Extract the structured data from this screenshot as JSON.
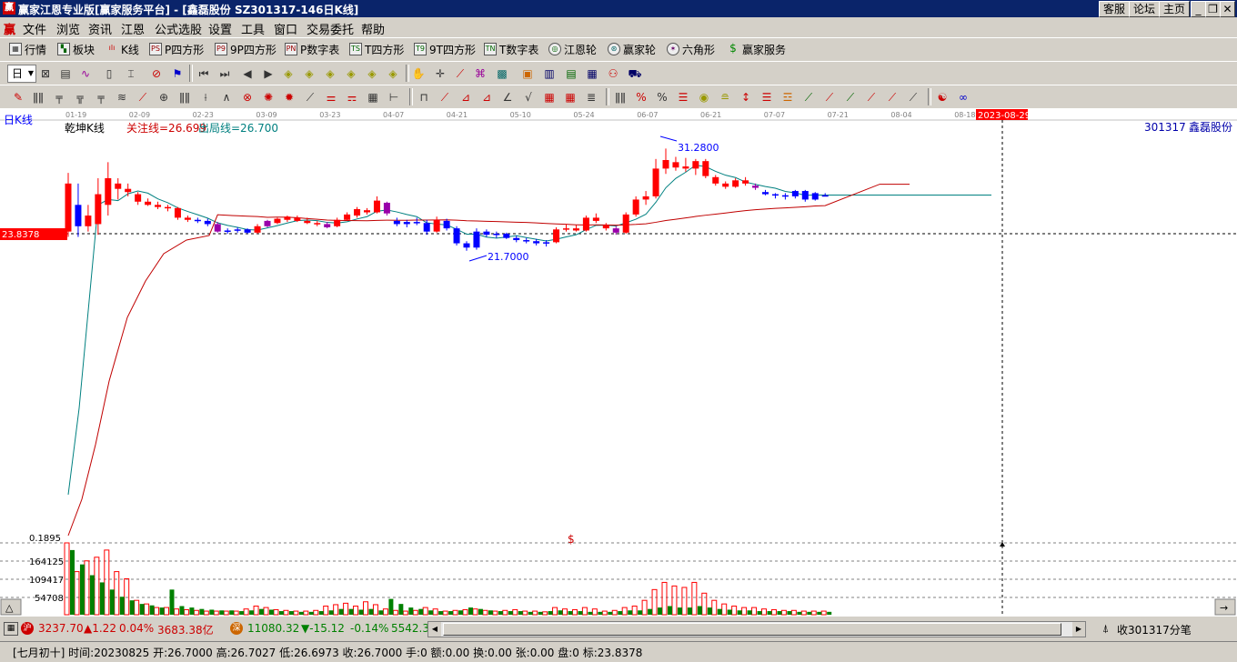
{
  "window": {
    "app_icon": "赢",
    "title": "赢家江恩专业版[赢家服务平台] - [鑫磊股份  SZ301317-146日K线]",
    "buttons": [
      "客服",
      "论坛",
      "主页"
    ]
  },
  "menu": [
    "文件",
    "浏览",
    "资讯",
    "江恩",
    "公式选股",
    "设置",
    "工具",
    "窗口",
    "交易委托",
    "帮助"
  ],
  "toolbar1": [
    {
      "icon": "market-icon",
      "label": "行情"
    },
    {
      "icon": "sector-icon",
      "label": "板块"
    },
    {
      "icon": "kline-icon",
      "label": "K线"
    },
    {
      "icon": "ps-icon",
      "label": "P四方形"
    },
    {
      "icon": "p9-icon",
      "label": "9P四方形"
    },
    {
      "icon": "pn-icon",
      "label": "P数字表"
    },
    {
      "icon": "ts-icon",
      "label": "T四方形"
    },
    {
      "icon": "t9-icon",
      "label": "9T四方形"
    },
    {
      "icon": "tn-icon",
      "label": "T数字表"
    },
    {
      "icon": "gann-wheel-icon",
      "label": "江恩轮"
    },
    {
      "icon": "winner-wheel-icon",
      "label": "赢家轮"
    },
    {
      "icon": "hexagon-icon",
      "label": "六角形"
    },
    {
      "icon": "service-icon",
      "label": "赢家服务"
    }
  ],
  "period_select": "日",
  "chart": {
    "corner_label": "日K线",
    "indicator_name": "乾坤K线",
    "focus_label": "关注线=26.699",
    "exit_label": "出局线=26.700",
    "stock_code": "301317",
    "stock_name": "鑫磊股份",
    "price_marker": "23.8378",
    "high_annotation": "31.2800",
    "low_annotation": "21.7000",
    "cursor_date": "2023-08-29",
    "date_ticks": [
      "01-19",
      "02-09",
      "02-23",
      "03-09",
      "03-23",
      "04-07",
      "04-21",
      "05-10",
      "05-24",
      "06-07",
      "06-21",
      "07-07",
      "07-21",
      "08-04",
      "08-18"
    ],
    "volume_labels": [
      "0.1895",
      "164125",
      "109417",
      "54708"
    ],
    "dollar_mark": "$",
    "colors": {
      "up": "#ff0000",
      "down": "#0000ff",
      "purple": "#9900aa",
      "vol_up": "#ff0000",
      "vol_down": "#008000",
      "ma_short": "#008080",
      "ma_long": "#c00000"
    }
  },
  "chart_data": {
    "type": "candlestick",
    "ylim": [
      10,
      35
    ],
    "candles": [
      {
        "o": 23.5,
        "h": 29.0,
        "l": 23.0,
        "c": 28.0,
        "d": "u"
      },
      {
        "o": 26.0,
        "h": 28.0,
        "l": 23.0,
        "c": 24.0,
        "d": "d"
      },
      {
        "o": 24.0,
        "h": 26.0,
        "l": 23.5,
        "c": 25.0,
        "d": "u"
      },
      {
        "o": 24.2,
        "h": 28.5,
        "l": 23.2,
        "c": 27.0,
        "d": "u"
      },
      {
        "o": 26.0,
        "h": 30.0,
        "l": 25.0,
        "c": 28.5,
        "d": "u"
      },
      {
        "o": 28.0,
        "h": 28.5,
        "l": 26.5,
        "c": 27.5,
        "d": "u"
      },
      {
        "o": 27.5,
        "h": 28.0,
        "l": 26.8,
        "c": 27.2,
        "d": "u"
      },
      {
        "o": 27.0,
        "h": 27.2,
        "l": 26.0,
        "c": 26.3,
        "d": "u"
      },
      {
        "o": 26.3,
        "h": 26.6,
        "l": 25.9,
        "c": 26.0,
        "d": "u"
      },
      {
        "o": 26.0,
        "h": 26.3,
        "l": 25.6,
        "c": 25.8,
        "d": "u"
      },
      {
        "o": 25.8,
        "h": 26.0,
        "l": 25.4,
        "c": 25.7,
        "d": "u"
      },
      {
        "o": 25.7,
        "h": 25.8,
        "l": 24.6,
        "c": 24.8,
        "d": "u"
      },
      {
        "o": 24.8,
        "h": 25.0,
        "l": 24.4,
        "c": 24.6,
        "d": "u"
      },
      {
        "o": 24.6,
        "h": 24.8,
        "l": 24.3,
        "c": 24.5,
        "d": "d"
      },
      {
        "o": 24.5,
        "h": 24.7,
        "l": 24.0,
        "c": 24.2,
        "d": "d"
      },
      {
        "o": 24.2,
        "h": 24.4,
        "l": 23.4,
        "c": 23.5,
        "d": "p"
      },
      {
        "o": 23.5,
        "h": 23.8,
        "l": 23.3,
        "c": 23.6,
        "d": "d"
      },
      {
        "o": 23.6,
        "h": 23.9,
        "l": 23.4,
        "c": 23.7,
        "d": "d"
      },
      {
        "o": 23.7,
        "h": 23.8,
        "l": 23.3,
        "c": 23.4,
        "d": "d"
      },
      {
        "o": 23.4,
        "h": 24.2,
        "l": 23.3,
        "c": 24.0,
        "d": "u"
      },
      {
        "o": 24.0,
        "h": 24.6,
        "l": 23.9,
        "c": 24.5,
        "d": "p"
      },
      {
        "o": 24.3,
        "h": 24.8,
        "l": 24.2,
        "c": 24.7,
        "d": "u"
      },
      {
        "o": 24.6,
        "h": 25.0,
        "l": 24.4,
        "c": 24.9,
        "d": "u"
      },
      {
        "o": 24.8,
        "h": 25.0,
        "l": 24.4,
        "c": 24.5,
        "d": "u"
      },
      {
        "o": 24.5,
        "h": 24.8,
        "l": 24.2,
        "c": 24.3,
        "d": "u"
      },
      {
        "o": 24.3,
        "h": 24.5,
        "l": 24.0,
        "c": 24.2,
        "d": "u"
      },
      {
        "o": 24.2,
        "h": 24.4,
        "l": 23.8,
        "c": 23.9,
        "d": "p"
      },
      {
        "o": 24.0,
        "h": 24.8,
        "l": 23.9,
        "c": 24.6,
        "d": "u"
      },
      {
        "o": 24.6,
        "h": 25.3,
        "l": 24.5,
        "c": 25.1,
        "d": "u"
      },
      {
        "o": 25.0,
        "h": 25.8,
        "l": 24.8,
        "c": 25.6,
        "d": "u"
      },
      {
        "o": 25.5,
        "h": 25.7,
        "l": 25.1,
        "c": 25.3,
        "d": "u"
      },
      {
        "o": 25.3,
        "h": 26.8,
        "l": 25.2,
        "c": 26.4,
        "d": "u"
      },
      {
        "o": 26.2,
        "h": 26.3,
        "l": 25.0,
        "c": 25.2,
        "d": "p"
      },
      {
        "o": 24.5,
        "h": 24.8,
        "l": 24.0,
        "c": 24.2,
        "d": "d"
      },
      {
        "o": 24.2,
        "h": 24.6,
        "l": 23.9,
        "c": 24.4,
        "d": "d"
      },
      {
        "o": 24.4,
        "h": 24.8,
        "l": 24.1,
        "c": 24.3,
        "d": "d"
      },
      {
        "o": 24.3,
        "h": 24.6,
        "l": 23.2,
        "c": 23.5,
        "d": "d"
      },
      {
        "o": 23.5,
        "h": 24.9,
        "l": 23.4,
        "c": 24.6,
        "d": "u"
      },
      {
        "o": 24.5,
        "h": 24.7,
        "l": 23.6,
        "c": 23.8,
        "d": "d"
      },
      {
        "o": 23.8,
        "h": 24.0,
        "l": 22.2,
        "c": 22.4,
        "d": "d"
      },
      {
        "o": 22.4,
        "h": 22.6,
        "l": 21.7,
        "c": 22.0,
        "d": "d"
      },
      {
        "o": 22.0,
        "h": 23.8,
        "l": 21.8,
        "c": 23.5,
        "d": "d"
      },
      {
        "o": 23.5,
        "h": 23.7,
        "l": 23.0,
        "c": 23.2,
        "d": "d"
      },
      {
        "o": 23.2,
        "h": 23.5,
        "l": 22.9,
        "c": 23.3,
        "d": "d"
      },
      {
        "o": 23.3,
        "h": 23.4,
        "l": 22.8,
        "c": 22.9,
        "d": "d"
      },
      {
        "o": 22.9,
        "h": 23.1,
        "l": 22.5,
        "c": 22.7,
        "d": "d"
      },
      {
        "o": 22.7,
        "h": 22.9,
        "l": 22.4,
        "c": 22.6,
        "d": "d"
      },
      {
        "o": 22.6,
        "h": 22.8,
        "l": 22.2,
        "c": 22.4,
        "d": "d"
      },
      {
        "o": 22.4,
        "h": 22.7,
        "l": 22.1,
        "c": 22.5,
        "d": "d"
      },
      {
        "o": 22.5,
        "h": 23.9,
        "l": 22.4,
        "c": 23.7,
        "d": "u"
      },
      {
        "o": 23.7,
        "h": 24.2,
        "l": 23.5,
        "c": 23.8,
        "d": "u"
      },
      {
        "o": 23.8,
        "h": 24.1,
        "l": 23.5,
        "c": 23.6,
        "d": "u"
      },
      {
        "o": 23.6,
        "h": 25.0,
        "l": 23.5,
        "c": 24.8,
        "d": "u"
      },
      {
        "o": 24.8,
        "h": 25.2,
        "l": 24.3,
        "c": 24.5,
        "d": "u"
      },
      {
        "o": 24.1,
        "h": 24.3,
        "l": 23.6,
        "c": 23.8,
        "d": "u"
      },
      {
        "o": 23.8,
        "h": 24.0,
        "l": 23.2,
        "c": 23.4,
        "d": "p"
      },
      {
        "o": 23.4,
        "h": 25.3,
        "l": 23.3,
        "c": 25.1,
        "d": "u"
      },
      {
        "o": 25.1,
        "h": 26.8,
        "l": 24.9,
        "c": 26.5,
        "d": "u"
      },
      {
        "o": 26.5,
        "h": 27.3,
        "l": 26.0,
        "c": 26.8,
        "d": "u"
      },
      {
        "o": 26.8,
        "h": 30.3,
        "l": 26.6,
        "c": 29.4,
        "d": "u"
      },
      {
        "o": 29.4,
        "h": 31.28,
        "l": 28.9,
        "c": 30.2,
        "d": "u"
      },
      {
        "o": 30.0,
        "h": 30.5,
        "l": 29.2,
        "c": 29.5,
        "d": "u"
      },
      {
        "o": 29.6,
        "h": 30.4,
        "l": 29.1,
        "c": 29.4,
        "d": "u"
      },
      {
        "o": 29.4,
        "h": 30.3,
        "l": 28.8,
        "c": 30.1,
        "d": "u"
      },
      {
        "o": 30.1,
        "h": 30.3,
        "l": 28.5,
        "c": 28.7,
        "d": "u"
      },
      {
        "o": 28.6,
        "h": 28.8,
        "l": 27.8,
        "c": 28.0,
        "d": "u"
      },
      {
        "o": 28.0,
        "h": 28.2,
        "l": 27.5,
        "c": 27.7,
        "d": "u"
      },
      {
        "o": 27.7,
        "h": 28.5,
        "l": 27.6,
        "c": 28.3,
        "d": "u"
      },
      {
        "o": 28.3,
        "h": 28.6,
        "l": 27.8,
        "c": 28.0,
        "d": "u"
      },
      {
        "o": 27.8,
        "h": 28.0,
        "l": 27.4,
        "c": 27.6,
        "d": "p"
      },
      {
        "o": 27.2,
        "h": 27.4,
        "l": 26.9,
        "c": 27.0,
        "d": "d"
      },
      {
        "o": 27.0,
        "h": 27.1,
        "l": 26.6,
        "c": 26.9,
        "d": "d"
      },
      {
        "o": 26.9,
        "h": 27.1,
        "l": 26.5,
        "c": 26.8,
        "d": "d"
      },
      {
        "o": 26.8,
        "h": 27.4,
        "l": 26.6,
        "c": 27.3,
        "d": "d"
      },
      {
        "o": 27.3,
        "h": 27.4,
        "l": 26.3,
        "c": 26.5,
        "d": "d"
      },
      {
        "o": 26.5,
        "h": 27.2,
        "l": 26.4,
        "c": 27.1,
        "d": "d"
      },
      {
        "o": 26.9,
        "h": 27.1,
        "l": 26.8,
        "c": 26.9,
        "d": "d"
      }
    ],
    "volumes_up": [
      1.0,
      0.6,
      0.75,
      0.8,
      0.9,
      0.6,
      0.5,
      0.2,
      0.15,
      0.1,
      0.1,
      0.08,
      0.07,
      0.06,
      0.05,
      0.05,
      0.05,
      0.05,
      0.08,
      0.12,
      0.1,
      0.07,
      0.06,
      0.05,
      0.05,
      0.06,
      0.12,
      0.14,
      0.16,
      0.12,
      0.18,
      0.14,
      0.08,
      0.06,
      0.05,
      0.06,
      0.1,
      0.08,
      0.05,
      0.06,
      0.07,
      0.08,
      0.06,
      0.05,
      0.06,
      0.07,
      0.05,
      0.05,
      0.04,
      0.1,
      0.08,
      0.07,
      0.1,
      0.08,
      0.05,
      0.06,
      0.1,
      0.12,
      0.2,
      0.35,
      0.45,
      0.4,
      0.38,
      0.45,
      0.3,
      0.2,
      0.15,
      0.12,
      0.1,
      0.1,
      0.08,
      0.07,
      0.06,
      0.06,
      0.05,
      0.05,
      0.05
    ],
    "volumes_down": [
      0.9,
      0.7,
      0.55,
      0.45,
      0.35,
      0.25,
      0.2,
      0.15,
      0.13,
      0.1,
      0.35,
      0.12,
      0.1,
      0.08,
      0.07,
      0.06,
      0.06,
      0.05,
      0.06,
      0.08,
      0.07,
      0.05,
      0.05,
      0.04,
      0.04,
      0.05,
      0.06,
      0.08,
      0.08,
      0.07,
      0.08,
      0.06,
      0.22,
      0.15,
      0.1,
      0.08,
      0.06,
      0.05,
      0.05,
      0.06,
      0.1,
      0.08,
      0.06,
      0.05,
      0.05,
      0.05,
      0.04,
      0.04,
      0.05,
      0.06,
      0.05,
      0.05,
      0.04,
      0.04,
      0.04,
      0.05,
      0.06,
      0.06,
      0.08,
      0.1,
      0.12,
      0.1,
      0.1,
      0.12,
      0.1,
      0.08,
      0.07,
      0.06,
      0.06,
      0.05,
      0.05,
      0.05,
      0.05,
      0.04,
      0.04,
      0.04,
      0.04
    ]
  },
  "statusbar": {
    "sh_icon": "沪",
    "sh_index": "3237.70",
    "sh_change": "▲1.22",
    "sh_pct": "0.04%",
    "sh_amount": "3683.38亿",
    "sz_icon": "深",
    "sz_index": "11080.32",
    "sz_change": "▼-15.12",
    "sz_pct": "-0.14%",
    "sz_amount": "5542.3",
    "right_text": "收301317分笔"
  },
  "infobar": {
    "text": "[七月初十] 时间:20230825 开:26.7000 高:26.7027 低:26.6973 收:26.7000 手:0 额:0.00 换:0.00 张:0.00 盘:0 标:23.8378"
  }
}
